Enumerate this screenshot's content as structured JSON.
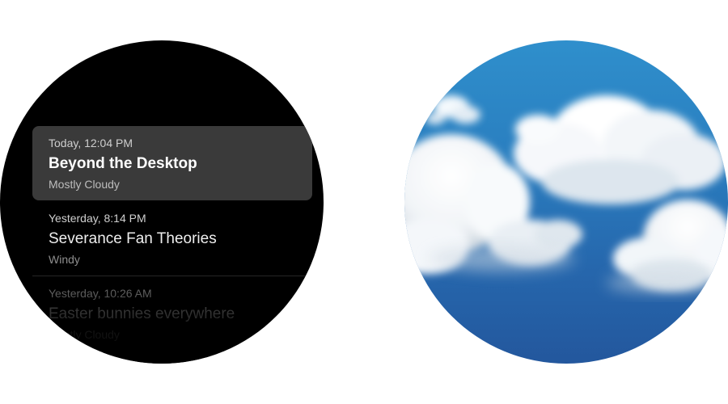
{
  "history": {
    "items": [
      {
        "time": "Today, 12:04 PM",
        "title": "Beyond the Desktop",
        "subtitle": "Mostly Cloudy",
        "selected": true
      },
      {
        "time": "Yesterday, 8:14 PM",
        "title": "Severance Fan Theories",
        "subtitle": "Windy",
        "selected": false
      },
      {
        "time": "Yesterday, 10:26 AM",
        "title": "Easter bunnies everywhere",
        "subtitle": "Mostly Cloudy",
        "selected": false
      }
    ]
  },
  "weather_visual": {
    "icon": "cloudy-sky-image"
  },
  "colors": {
    "watch_background": "#000000",
    "selected_item": "#3a3a3a",
    "sky_top": "#2f8fcc",
    "sky_bottom": "#23579d"
  }
}
